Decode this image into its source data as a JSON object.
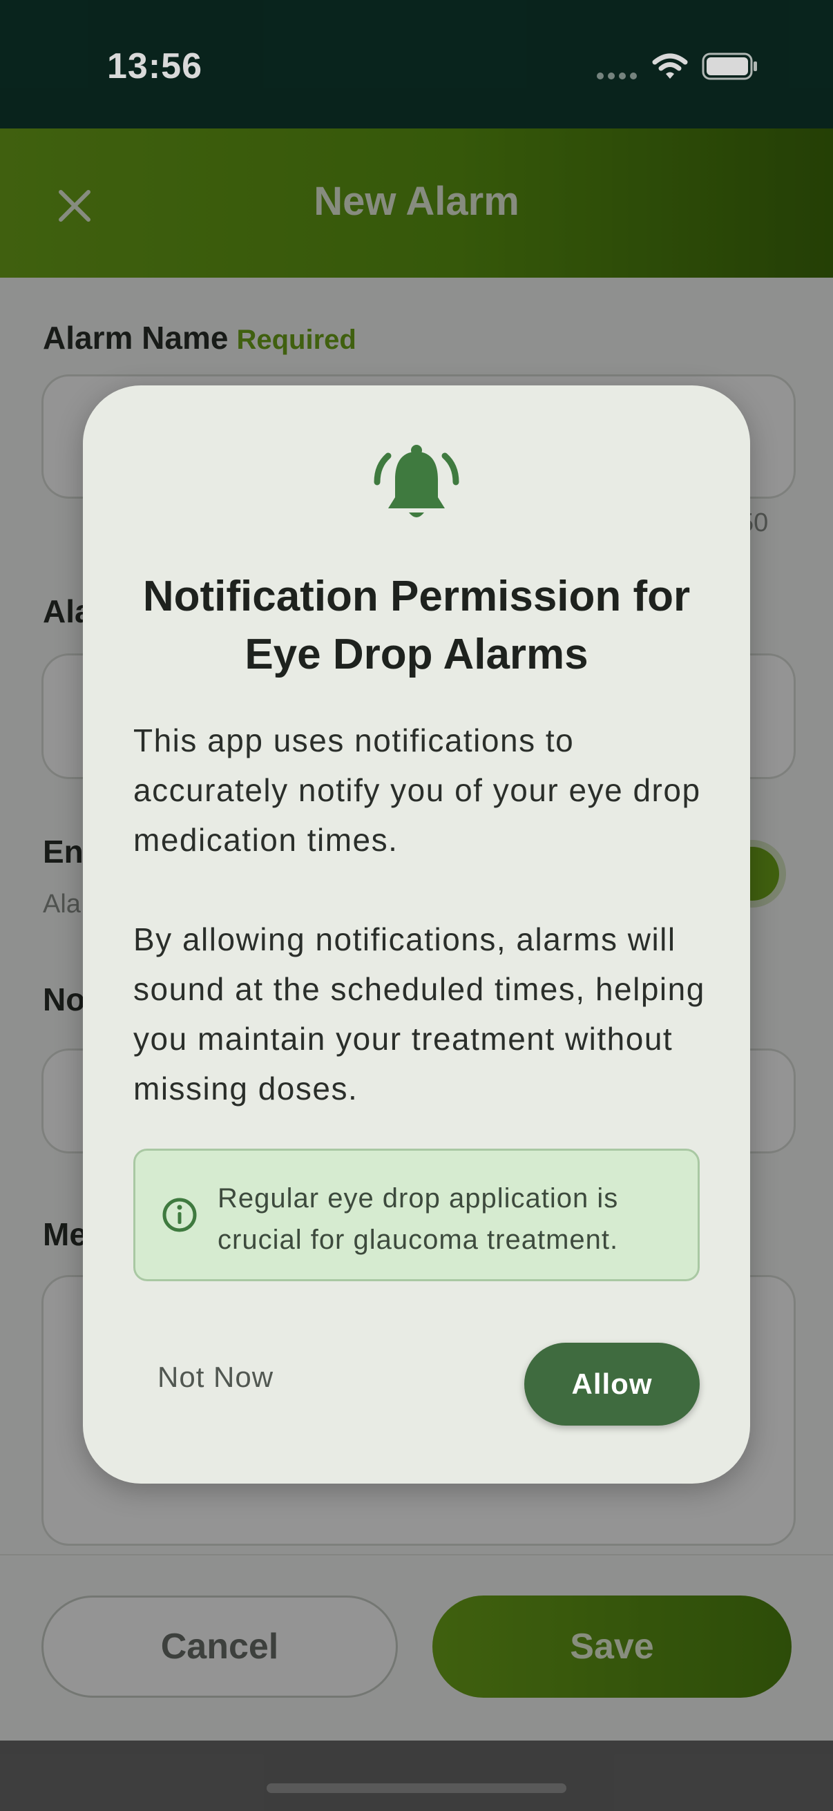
{
  "status_bar": {
    "time": "13:56"
  },
  "header": {
    "title": "New Alarm"
  },
  "form": {
    "alarm_name": {
      "label": "Alarm Name",
      "required_tag": "Required",
      "char_count": "50"
    },
    "section2_label": "Ala",
    "section3_label": "En",
    "section3_sub": "Ala",
    "section4_label": "No",
    "section5_label": "Me"
  },
  "footer": {
    "cancel_label": "Cancel",
    "save_label": "Save"
  },
  "dialog": {
    "icon": "bell-icon",
    "title": "Notification Permission for Eye Drop Alarms",
    "body_paragraph_1": "This app uses notifications to accurately notify you of your eye drop medication times.",
    "body_paragraph_2": "By allowing notifications, alarms will sound at the scheduled times, helping you maintain your treatment without missing doses.",
    "info_text": "Regular eye drop application is crucial for glaucoma treatment.",
    "not_now_label": "Not Now",
    "allow_label": "Allow"
  },
  "colors": {
    "header_green": "#6ea61a",
    "dialog_bg": "#e8ebe4",
    "allow_button": "#3f6b3f",
    "info_bg": "#d6ebd0"
  }
}
